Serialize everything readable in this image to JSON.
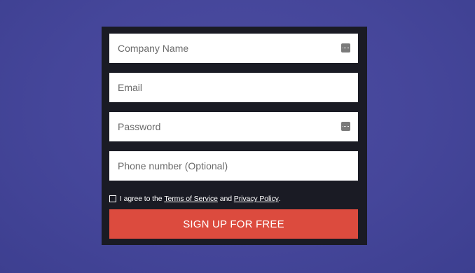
{
  "form": {
    "fields": [
      {
        "placeholder": "Company Name",
        "value": "",
        "has_password_icon": true
      },
      {
        "placeholder": "Email",
        "value": "",
        "has_password_icon": false
      },
      {
        "placeholder": "Password",
        "value": "",
        "has_password_icon": true
      },
      {
        "placeholder": "Phone number (Optional)",
        "value": "",
        "has_password_icon": false
      }
    ],
    "agree": {
      "prefix": "I agree to the",
      "terms_link": "Terms of Service",
      "and": "and",
      "privacy_link": "Privacy Policy",
      "suffix": ".",
      "checked": false
    },
    "submit_label": "SIGN UP FOR FREE"
  },
  "colors": {
    "background": "#45469a",
    "panel": "#1a1b24",
    "button": "#dc4b3e",
    "field": "#ffffff"
  },
  "icons": {
    "field_icon": "password-manager-icon"
  }
}
